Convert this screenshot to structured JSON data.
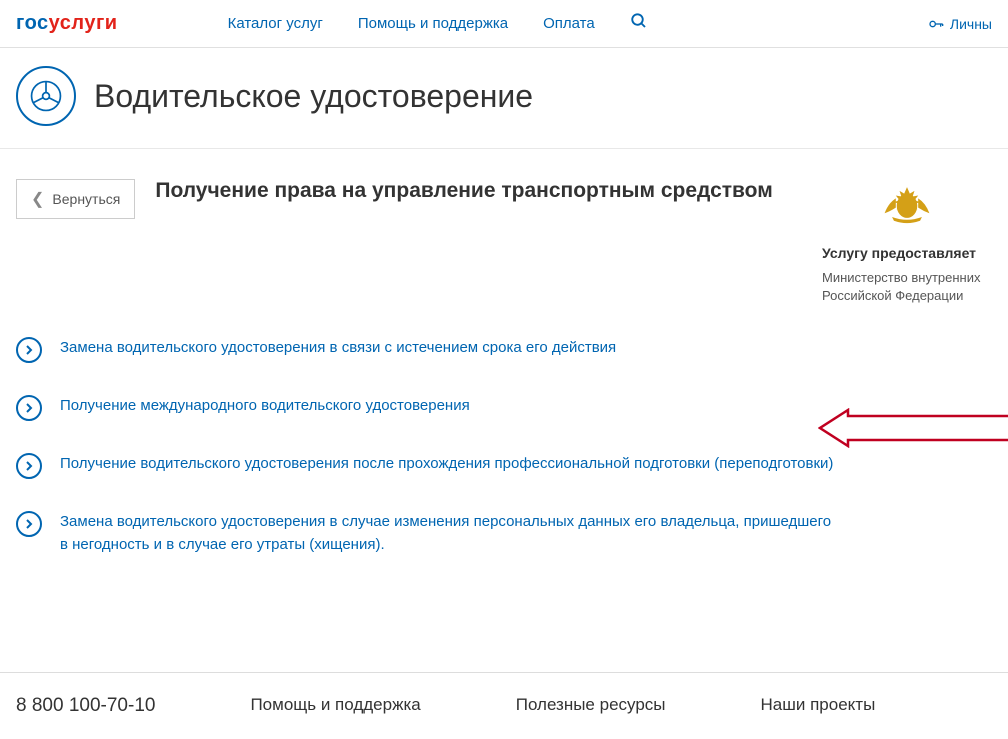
{
  "header": {
    "logo_part1": "гос",
    "logo_part2": "услуги",
    "nav": {
      "catalog": "Каталог услуг",
      "help": "Помощь и поддержка",
      "payment": "Оплата"
    },
    "personal": "Личны"
  },
  "page": {
    "title": "Водительское удостоверение",
    "back": "Вернуться",
    "subtitle": "Получение права на управление транспортным средством"
  },
  "provider": {
    "label": "Услугу предоставляет",
    "name": "Министерство внутренних Российской Федерации"
  },
  "services": [
    "Замена водительского удостоверения в связи с истечением срока его действия",
    "Получение международного водительского удостоверения",
    "Получение водительского удостоверения после прохождения профессиональной подготовки (переподготовки)",
    "Замена водительского удостоверения в случае изменения персональных данных его владельца, пришедшего в негодность и в случае его утраты (хищения)."
  ],
  "footer": {
    "phone": "8 800 100-70-10",
    "help": "Помощь и поддержка",
    "resources": "Полезные ресурсы",
    "projects": "Наши проекты"
  }
}
